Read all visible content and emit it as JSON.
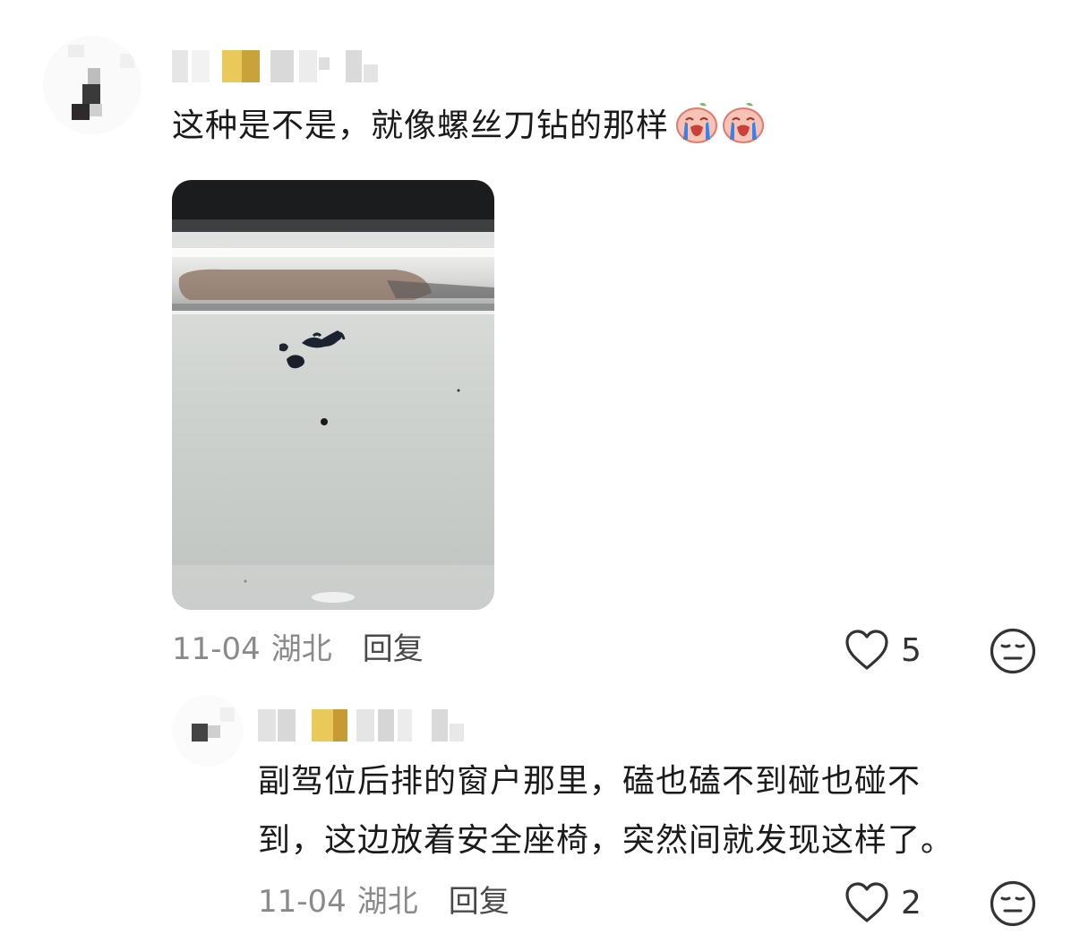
{
  "comments": [
    {
      "text": "这种是不是，就像螺丝刀钻的那样",
      "emojis": [
        "crying-face-emoji",
        "crying-face-emoji"
      ],
      "has_photo": true,
      "date": "11-04",
      "location": "湖北",
      "reply_label": "回复",
      "like_count": "5"
    }
  ],
  "reply": {
    "text_line1": "副驾位后排的窗户那里，磕也磕不到碰也碰不",
    "text_line2": "到，这边放着安全座椅，突然间就发现这样了。",
    "date": "11-04",
    "location": "湖北",
    "reply_label": "回复",
    "like_count": "2"
  },
  "icons": {
    "like": "heart-outline-icon",
    "reaction": "neutral-face-icon"
  },
  "colors": {
    "meta_text": "#8a8a8a",
    "reply_link": "#4a4a4a",
    "body_text": "#1a1a1a"
  }
}
